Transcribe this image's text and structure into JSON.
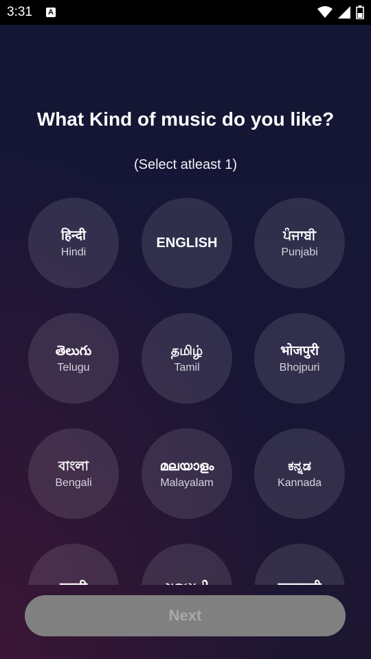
{
  "status_bar": {
    "time": "3:31",
    "notification_icon_letter": "A",
    "icons": [
      "wifi-icon",
      "signal-icon",
      "battery-icon"
    ]
  },
  "header": {
    "title": "What Kind of music do you like?",
    "subtitle": "(Select atleast 1)"
  },
  "languages": [
    {
      "native": "हिन्दी",
      "english": "Hindi"
    },
    {
      "native": "",
      "english": "ENGLISH"
    },
    {
      "native": "ਪੰਜਾਬੀ",
      "english": "Punjabi"
    },
    {
      "native": "తెలుగు",
      "english": "Telugu"
    },
    {
      "native": "தமிழ்",
      "english": "Tamil"
    },
    {
      "native": "भोजपुरी",
      "english": "Bhojpuri"
    },
    {
      "native": "বাংলা",
      "english": "Bengali"
    },
    {
      "native": "മലയാളം",
      "english": "Malayalam"
    },
    {
      "native": "ಕನ್ನಡ",
      "english": "Kannada"
    },
    {
      "native": "मराठी",
      "english": ""
    },
    {
      "native": "ગુજરાતી",
      "english": ""
    },
    {
      "native": "हरयाणवी",
      "english": ""
    }
  ],
  "footer": {
    "next_label": "Next"
  },
  "colors": {
    "bubble": "rgba(255,255,255,0.11)",
    "next_disabled_bg": "#808080",
    "next_disabled_text": "#a9a9a9"
  }
}
